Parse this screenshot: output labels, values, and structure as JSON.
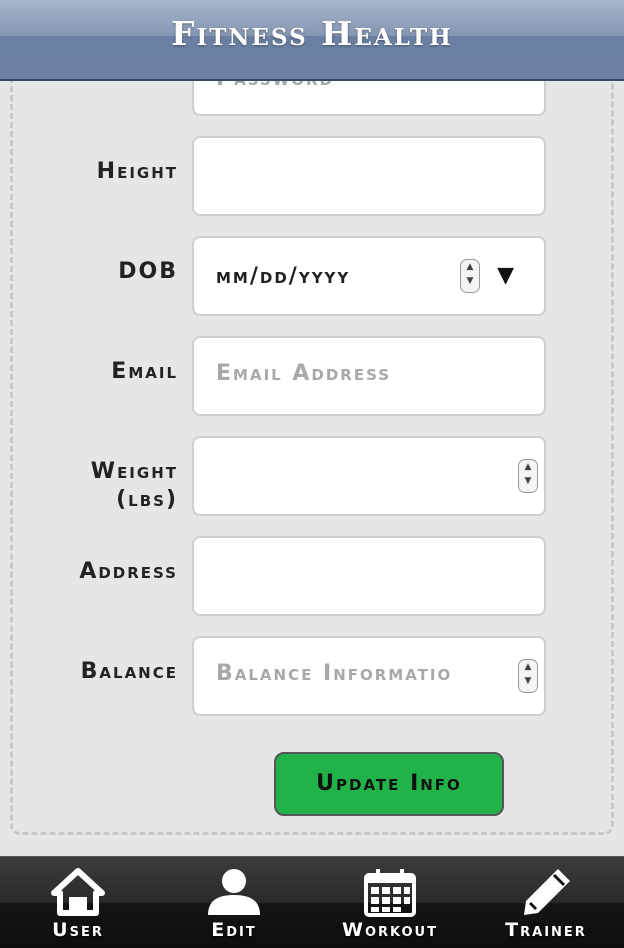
{
  "header": {
    "title": "Fitness Health"
  },
  "form": {
    "password_placeholder": "Password",
    "fields": [
      {
        "label": "Height",
        "value": "",
        "placeholder": ""
      },
      {
        "label": "DOB",
        "value": "mm/dd/yyyy",
        "placeholder": ""
      },
      {
        "label": "Email",
        "value": "",
        "placeholder": "Email Address"
      },
      {
        "label": "Weight",
        "label2": "(lbs)",
        "value": "",
        "placeholder": ""
      },
      {
        "label": "Address",
        "value": "",
        "placeholder": ""
      },
      {
        "label": "Balance",
        "value": "",
        "placeholder": "Balance Informatio"
      }
    ],
    "update_label": "Update Info"
  },
  "nav": {
    "items": [
      {
        "label": "User",
        "icon": "home-icon"
      },
      {
        "label": "Edit",
        "icon": "person-icon"
      },
      {
        "label": "Workout",
        "icon": "calendar-icon"
      },
      {
        "label": "Trainer",
        "icon": "pencil-icon"
      }
    ]
  },
  "colors": {
    "header": "#6c81a3",
    "update_button": "#21b24a",
    "nav_background": "#141414"
  }
}
